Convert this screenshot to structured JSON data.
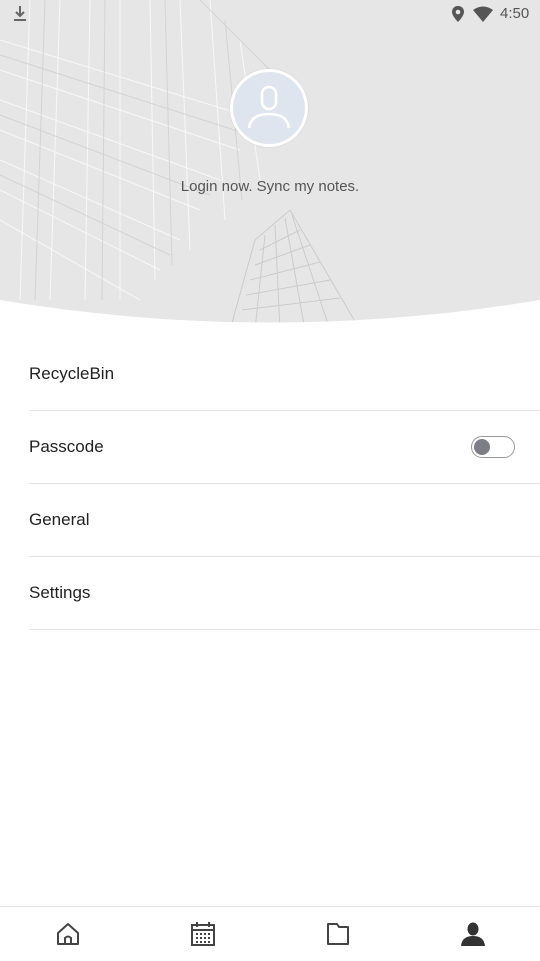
{
  "status_bar": {
    "time": "4:50",
    "icons": [
      "download-icon",
      "location-icon",
      "wifi-icon"
    ]
  },
  "profile": {
    "avatar_icon": "user-icon",
    "login_prompt": "Login now. Sync my notes."
  },
  "menu": {
    "items": [
      {
        "label": "RecycleBin"
      },
      {
        "label": "Passcode",
        "toggle": false
      },
      {
        "label": "General"
      },
      {
        "label": "Settings"
      }
    ]
  },
  "bottom_nav": {
    "items": [
      {
        "icon": "home-icon",
        "active": false
      },
      {
        "icon": "calendar-icon",
        "active": false
      },
      {
        "icon": "folder-icon",
        "active": false
      },
      {
        "icon": "profile-icon",
        "active": true
      }
    ]
  },
  "colors": {
    "header_bg": "#e6e6e6",
    "toggle_knob": "#7d7d86",
    "divider": "#e3e3e3",
    "active_icon": "#333333",
    "inactive_icon": "#444444"
  }
}
